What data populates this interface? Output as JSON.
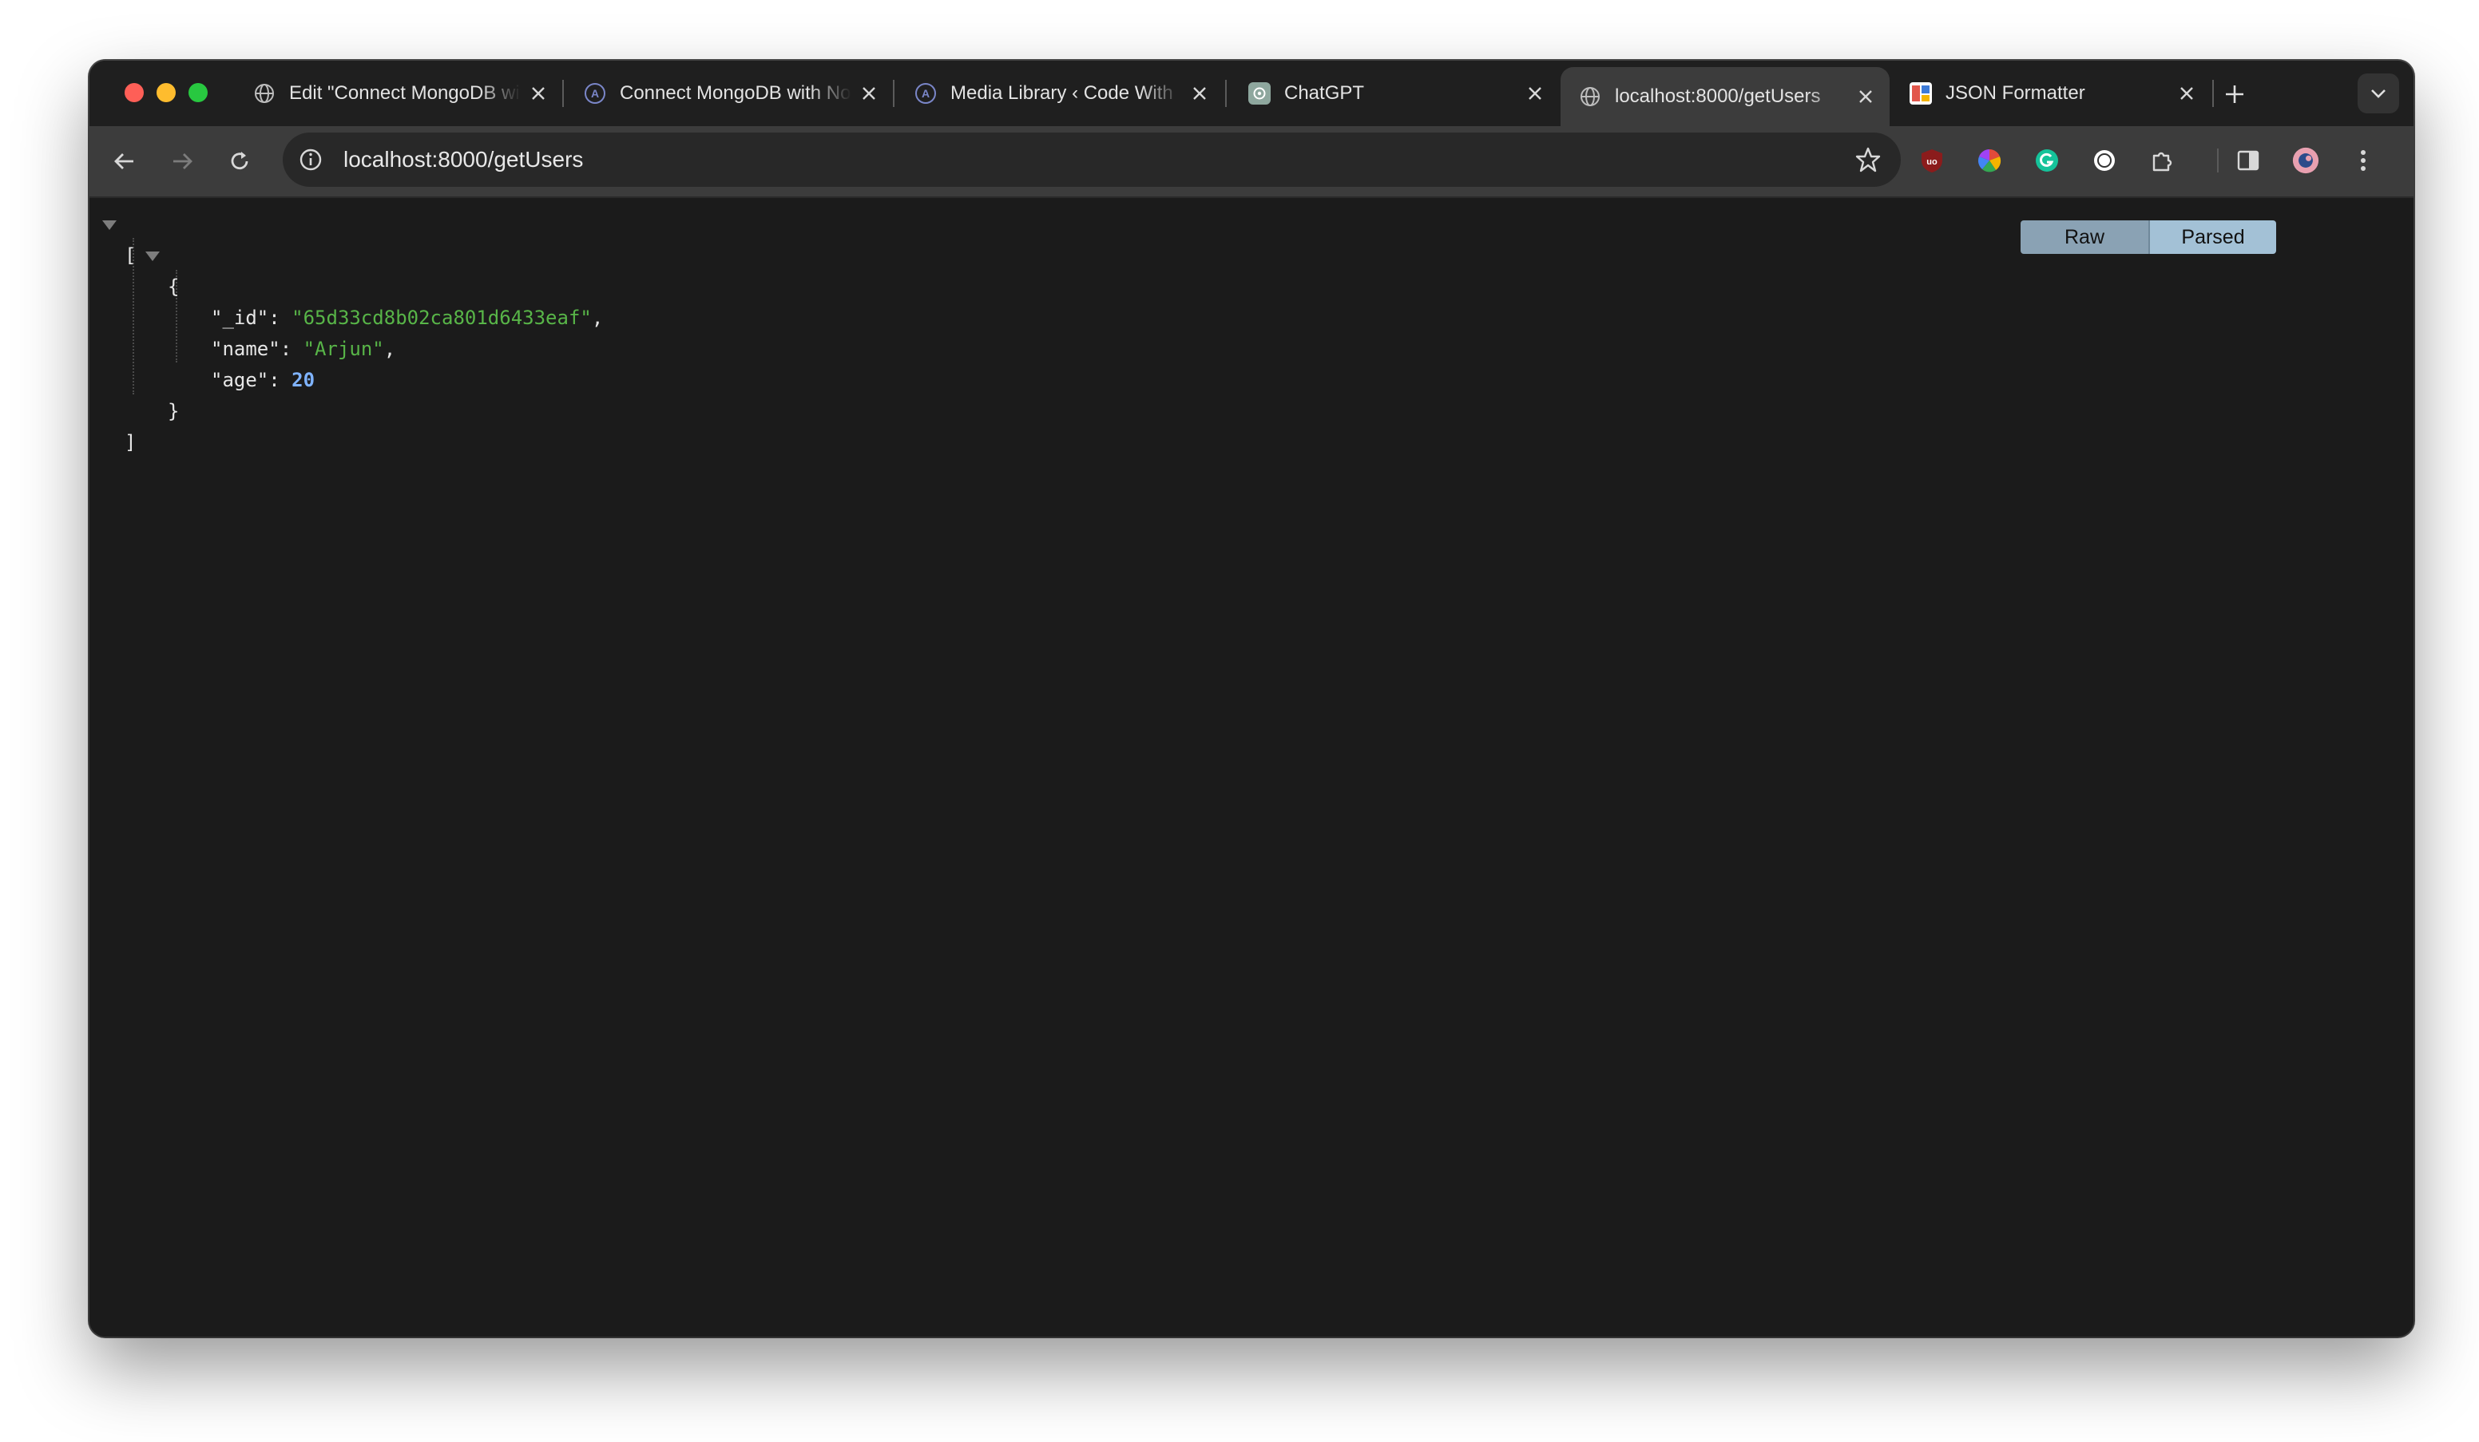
{
  "browser": {
    "tabs": [
      {
        "title": "Edit \"Connect MongoDB with",
        "icon": "globe-icon",
        "active": false
      },
      {
        "title": "Connect MongoDB with Node.js",
        "icon": "wordpress-icon",
        "active": false
      },
      {
        "title": "Media Library ‹ Code With",
        "icon": "wordpress-icon",
        "active": false
      },
      {
        "title": "ChatGPT",
        "icon": "chatgpt-icon",
        "active": false
      },
      {
        "title": "localhost:8000/getUsers",
        "icon": "globe-icon",
        "active": true
      },
      {
        "title": "JSON Formatter",
        "icon": "json-formatter-icon",
        "active": false
      }
    ],
    "address_bar": {
      "url": "localhost:8000/getUsers"
    },
    "extensions": [
      "ublock-icon",
      "color-picker-icon",
      "grammarly-icon",
      "circle-extension-icon",
      "extensions-puzzle-icon"
    ],
    "colors": {
      "accent_tab": "#3c3c3c",
      "frame": "#1f1f1f"
    }
  },
  "json_viewer": {
    "open_bracket": "[",
    "close_bracket": "]",
    "open_brace": "{",
    "close_brace": "}",
    "fields": [
      {
        "key": "\"_id\"",
        "value": "\"65d33cd8b02ca801d6433eaf\"",
        "type": "string",
        "comma": ","
      },
      {
        "key": "\"name\"",
        "value": "\"Arjun\"",
        "type": "string",
        "comma": ","
      },
      {
        "key": "\"age\"",
        "value": "20",
        "type": "number",
        "comma": ""
      }
    ],
    "view_toggle": {
      "raw_label": "Raw",
      "parsed_label": "Parsed",
      "selected": "Parsed"
    }
  }
}
